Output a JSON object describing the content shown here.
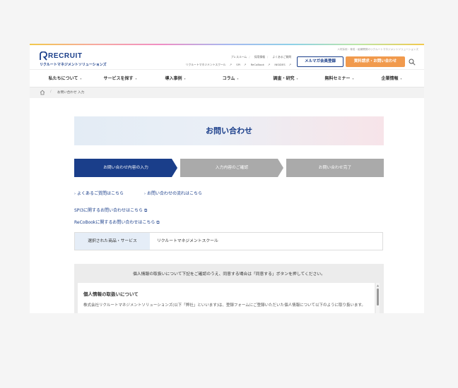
{
  "header": {
    "logo_text": "RECRUIT",
    "logo_subtext": "リクルートマネジメントソリューションズ",
    "tagline": "人材採用・育成・組織開発のリクルートマネジメントソリューションズ",
    "util_links_row1": [
      "プレスルーム",
      "採用情報",
      "よくあるご質問"
    ],
    "util_links_row2": [
      "リクルートマネジメントスクール",
      "SPI",
      "ReCoBook",
      "INSIDES"
    ],
    "magazine_button": "メルマガ会員登録",
    "contact_button": "資料請求・お問い合わせ"
  },
  "nav": {
    "items": [
      "私たちについて",
      "サービスを探す",
      "導入事例",
      "コラム",
      "調査・研究",
      "無料セミナー",
      "企業情報"
    ]
  },
  "breadcrumb": {
    "separator": "/",
    "current": "お問い合わせ 入力"
  },
  "main": {
    "title": "お問い合わせ",
    "steps": [
      "お問い合わせ内容の入力",
      "入力内容のご確認",
      "お問い合わせ完了"
    ],
    "active_step": 1,
    "faq_link": "よくあるご質問はこちら",
    "flow_link": "お問い合わせの流れはこちら",
    "spi_link": "SPI3に関するお問い合わせはこちら",
    "recobook_link": "ReCoBookに関するお問い合わせはこちら",
    "selected_label": "選択された商品・サービス",
    "selected_value": "リクルートマネジメントスクール",
    "privacy_intro": "個人情報の取扱いについて下記をご確認のうえ、同意する場合は「同意する」ボタンを押してください。",
    "privacy_title": "個人情報の取扱いについて",
    "privacy_body": "株式会社リクルートマネジメントソリューションズ(以下「弊社」といいます)は、登録フォームにご登録いただいた個人情報について以下のように取り扱います。"
  },
  "colors": {
    "brand_navy": "#1a3e8a",
    "accent_orange": "#f19a4d",
    "inactive_step": "#aaaaaa"
  }
}
